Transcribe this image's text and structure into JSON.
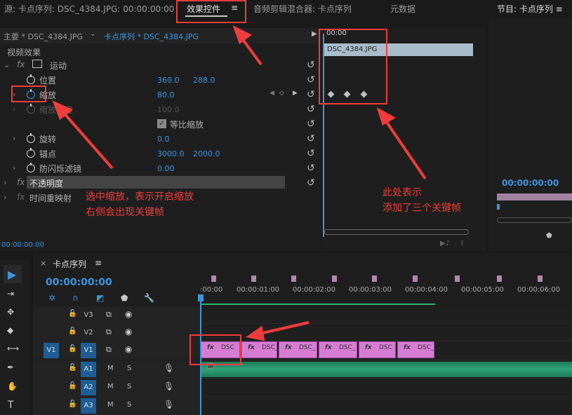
{
  "source_tab": "源: 卡点序列: DSC_4384.JPG: 00:00:00:00",
  "tabs": {
    "effect_controls": "效果控件",
    "menu": "≡",
    "audio_mixer": "音频剪辑混合器: 卡点序列",
    "metadata": "元数据"
  },
  "program_tab": "节目: 卡点序列 ≡",
  "subheader": {
    "master": "主要 * DSC_4384.JPG",
    "sequence": "卡点序列 * DSC_4384.JPG",
    "ruler_time": "00:00"
  },
  "video_effects": "视频效果",
  "motion": {
    "label": "运动",
    "position_label": "位置",
    "position_x": "360.0",
    "position_y": "288.0",
    "scale_label": "缩放",
    "scale_value": "80.0",
    "scale_width_label": "缩放宽度",
    "scale_width_value": "100.0",
    "uniform_scale": "等比缩放",
    "rotation_label": "旋转",
    "rotation_value": "0.0",
    "anchor_label": "锚点",
    "anchor_x": "3000.0",
    "anchor_y": "2000.0",
    "flicker_label": "防闪烁滤镜",
    "flicker_value": "0.00"
  },
  "opacity_label": "不透明度",
  "time_remap_label": "时间重映射",
  "clip_name": "DSC_4384.JPG",
  "ec_timecode": "00:00:00:00",
  "program_timecode": "00:00:00:00",
  "annotations": {
    "left_line1": "选中缩放，表示开启缩放",
    "left_line2": "右侧会出现关键帧",
    "right_line1": "此处表示",
    "right_line2": "添加了三个关键帧"
  },
  "timeline": {
    "close": "×",
    "title": "卡点序列",
    "menu": "≡",
    "timecode": "00:00:00:00",
    "ruler": [
      ":00:00",
      "00:00:01:00",
      "00:00:02:00",
      "00:00:03:00",
      "00:00:04:00",
      "00:00:05:00",
      "00:00:06:00"
    ],
    "tracks": [
      {
        "name": "V3",
        "src": ""
      },
      {
        "name": "V2",
        "src": ""
      },
      {
        "name": "V1",
        "src": "V1"
      },
      {
        "name": "A1",
        "src": "",
        "m": "M",
        "s": "S"
      },
      {
        "name": "A2",
        "src": "",
        "m": "M",
        "s": "S"
      },
      {
        "name": "A3",
        "src": "",
        "m": "M",
        "s": "S"
      }
    ],
    "clips": [
      {
        "fx": "fx",
        "name": "DSC"
      },
      {
        "fx": "fx",
        "name": "DSC_"
      },
      {
        "fx": "fx",
        "name": "DSC_"
      },
      {
        "fx": "fx",
        "name": "DSC_"
      },
      {
        "fx": "fx",
        "name": "DSC"
      },
      {
        "fx": "fx",
        "name": "DSC_"
      }
    ]
  },
  "colors": {
    "accent_blue": "#3d95e0",
    "annotation_red": "#f03c3c",
    "clip_pink": "#d77cd4",
    "audio_green": "#2fa27a"
  }
}
